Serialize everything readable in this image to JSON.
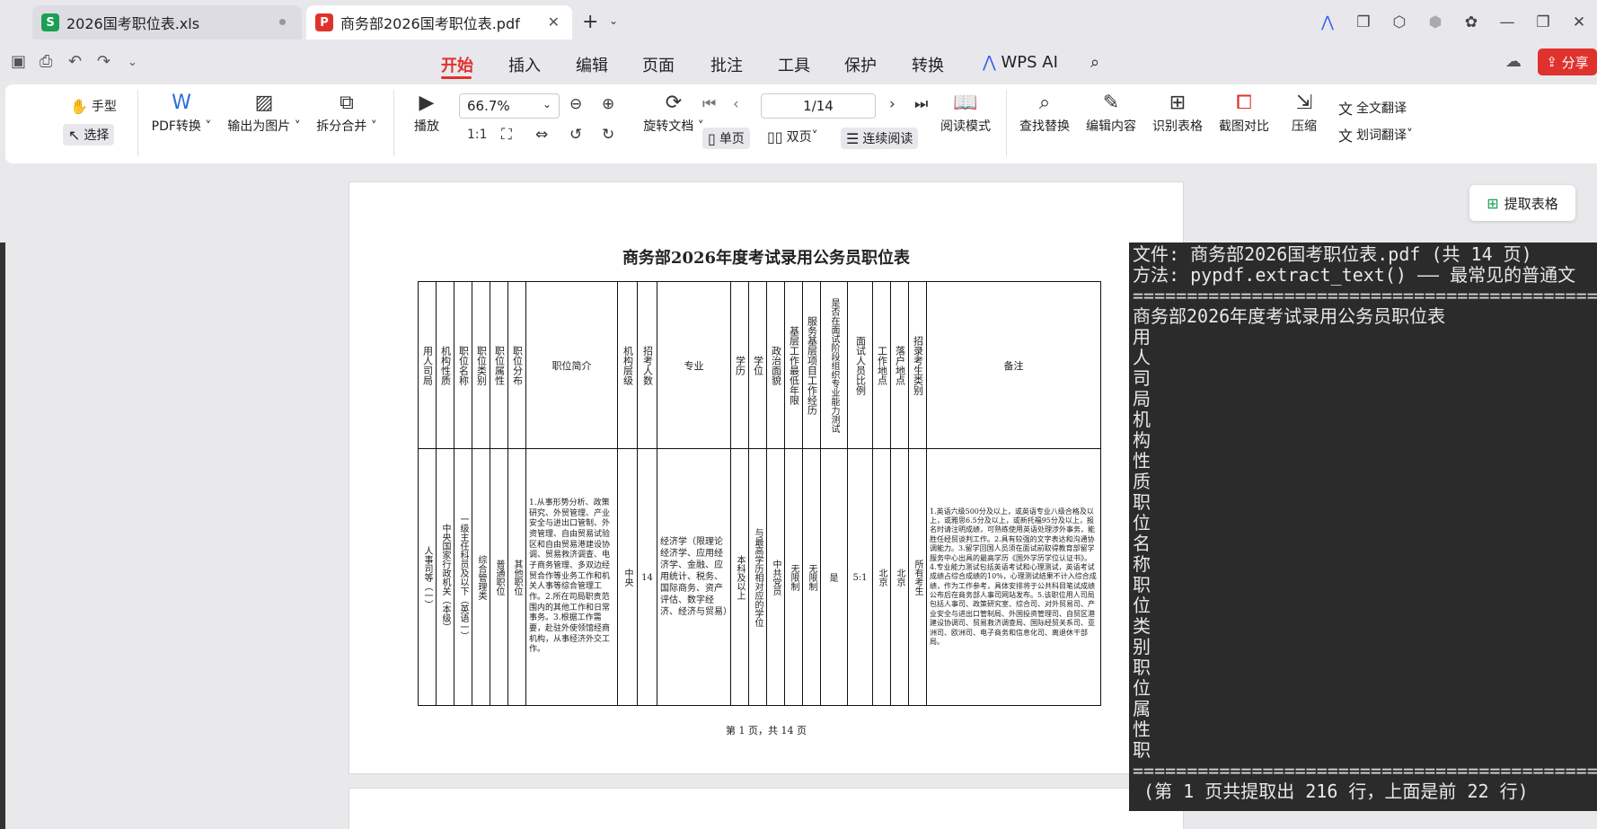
{
  "tabs": [
    {
      "label": "2026国考职位表.xls",
      "icon": "S",
      "icon_color": "#1a9f55",
      "active": false
    },
    {
      "label": "商务部2026国考职位表.pdf",
      "icon": "P",
      "icon_color": "#e0322d",
      "active": true
    }
  ],
  "menu": {
    "items": [
      "开始",
      "插入",
      "编辑",
      "页面",
      "批注",
      "工具",
      "保护",
      "转换"
    ],
    "active": "开始",
    "wps_ai": "WPS AI",
    "share": "分享"
  },
  "ribbon": {
    "hand": "手型",
    "select": "选择",
    "pdf_convert": "PDF转换",
    "export_image": "输出为图片",
    "split_merge": "拆分合并",
    "play": "播放",
    "zoom": "66.7%",
    "rotate": "旋转文档",
    "page_indicator": "1/14",
    "single": "单页",
    "double": "双页",
    "continuous": "连续阅读",
    "read_mode": "阅读模式",
    "find_replace": "查找替换",
    "edit_content": "编辑内容",
    "recognize_table": "识别表格",
    "screenshot_compare": "截图对比",
    "compress": "压缩",
    "full_translate": "全文翻译",
    "word_translate": "划词翻译"
  },
  "extract_table": "提取表格",
  "document": {
    "title": "商务部2026年度考试录用公务员职位表",
    "footer": "第 1 页，共 14 页",
    "headers": [
      "用人司局",
      "机构性质",
      "职位名称",
      "职位类别",
      "职位属性",
      "职位分布",
      "职位简介",
      "机构层级",
      "招考人数",
      "专业",
      "学历",
      "学位",
      "政治面貌",
      "基层工作最低年限",
      "服务基层项目工作经历",
      "是否在面试阶段组织专业能力测试",
      "面试人员比例",
      "工作地点",
      "落户地点",
      "招录考生类别",
      "备注"
    ],
    "row": {
      "dept": "人事司等（一）",
      "nature": "中央国家行政机关（本级）",
      "position": "一级主任科员及以下（英语一）",
      "category": "综合管理类",
      "attribute": "普通职位",
      "distribution": "其他职位",
      "intro": "1.从事形势分析、政策研究、外贸管理、产业安全与进出口管制、外资管理、自由贸易试验区和自由贸易港建设协调、贸易救济调查、电子商务管理、多双边经贸合作等业务工作和机关人事等综合管理工作。2.所在司局职责范围内的其他工作和日常事务。3.根据工作需要，赴驻外使领馆经商机构，从事经济外交工作。",
      "level": "中央",
      "count": "14",
      "major": "经济学（限理论经济学、应用经济学、金融、应用统计、税务、国际商务、资产评估、数字经济、经济与贸易）",
      "education": "本科及以上",
      "degree": "与最高学历相对应的学位",
      "political": "中共党员",
      "min_years": "无限制",
      "service_exp": "无限制",
      "skill_test": "是",
      "ratio": "5:1",
      "work_place": "北京",
      "settle_place": "北京",
      "candidate": "所有考生",
      "notes": "1.英语六级500分及以上，或英语专业八级合格及以上，或雅思6.5分及以上，或新托福95分及以上，报名时请注明成绩，可熟练使用英语处理涉外事务，能胜任经贸谈判工作。2.具有较强的文字表达和沟通协调能力。3.留学回国人员须在面试前取得教育部留学服务中心出具的最高学历《国外学历学位认证书》。4.专业能力测试包括英语考试和心理测试，英语考试成绩占综合成绩的10%，心理测试结果不计入综合成绩，作为工作参考，具体安排将于公共科目笔试成绩公布后在商务部人事司网站发布。5.该职位用人司局包括人事司、政策研究室、综合司、对外贸易司、产业安全与进出口管制局、外国投资管理司、自贸区港建设协调司、贸易救济调查局、国际经贸关系司、亚洲司、欧洲司、电子商务和信息化司、离退休干部局。"
    }
  },
  "terminal": {
    "lines": [
      "文件: 商务部2026国考职位表.pdf (共 14 页)",
      "方法: pypdf.extract_text() —— 最常见的普通文",
      "================================================",
      "商务部2026年度考试录用公务员职位表",
      "用",
      "人",
      "司",
      "局",
      "机",
      "构",
      "性",
      "质",
      "职",
      "位",
      "名",
      "称",
      "职",
      "位",
      "类",
      "别",
      "职",
      "位",
      "属",
      "性",
      "职",
      "================================================",
      " (第 1 页共提取出 216 行，上面是前 22 行)"
    ]
  }
}
